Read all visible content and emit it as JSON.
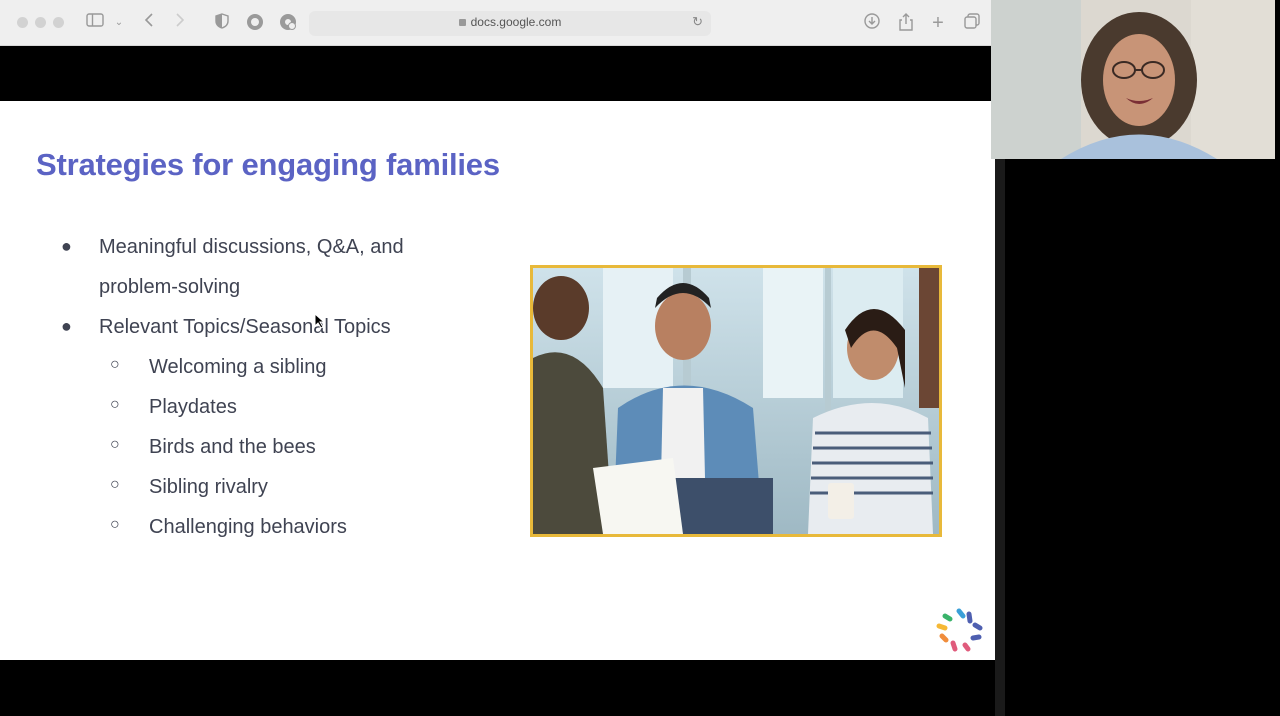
{
  "browser": {
    "url": "docs.google.com"
  },
  "slide": {
    "title": "Strategies for engaging families",
    "bullets": [
      {
        "line1": "Meaningful discussions, Q&A, and",
        "line2": "problem-solving"
      },
      {
        "line1": "Relevant Topics/Seasonal Topics"
      }
    ],
    "sub_bullets": [
      "Welcoming a sibling",
      "Playdates",
      "Birds and the bees",
      "Sibling rivalry",
      "Challenging behaviors"
    ],
    "image_alt": "group-discussion-photo",
    "colors": {
      "title": "#5b63c4",
      "text": "#3f4352",
      "photo_border": "#e8b93a"
    }
  },
  "icons": {
    "sidebar": "sidebar-icon",
    "back": "back-arrow-icon",
    "forward": "forward-arrow-icon",
    "shield": "shield-icon",
    "download": "download-icon",
    "share": "share-icon",
    "new_tab": "plus-icon",
    "tabs": "tab-overview-icon"
  }
}
